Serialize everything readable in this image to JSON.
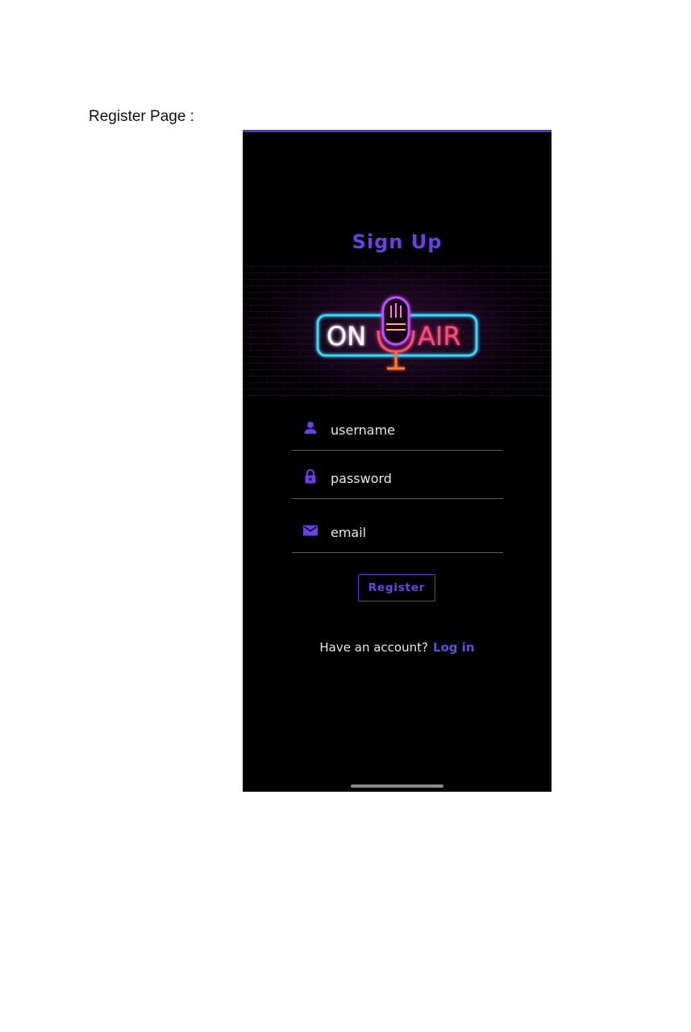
{
  "caption": "Register Page :",
  "screen": {
    "title": "Sign Up",
    "logo": {
      "text_left": "ON",
      "text_right": "AIR",
      "icon": "microphone-icon"
    },
    "fields": {
      "username": {
        "placeholder": "username",
        "icon": "person-icon"
      },
      "password": {
        "placeholder": "password",
        "icon": "lock-icon"
      },
      "email": {
        "placeholder": "email",
        "icon": "mail-icon"
      }
    },
    "register_label": "Register",
    "login_prompt": "Have an account?",
    "login_link": "Log in"
  },
  "colors": {
    "accent": "#6a3fe6",
    "background": "#000000",
    "top_bar": "#5b2fe0"
  }
}
